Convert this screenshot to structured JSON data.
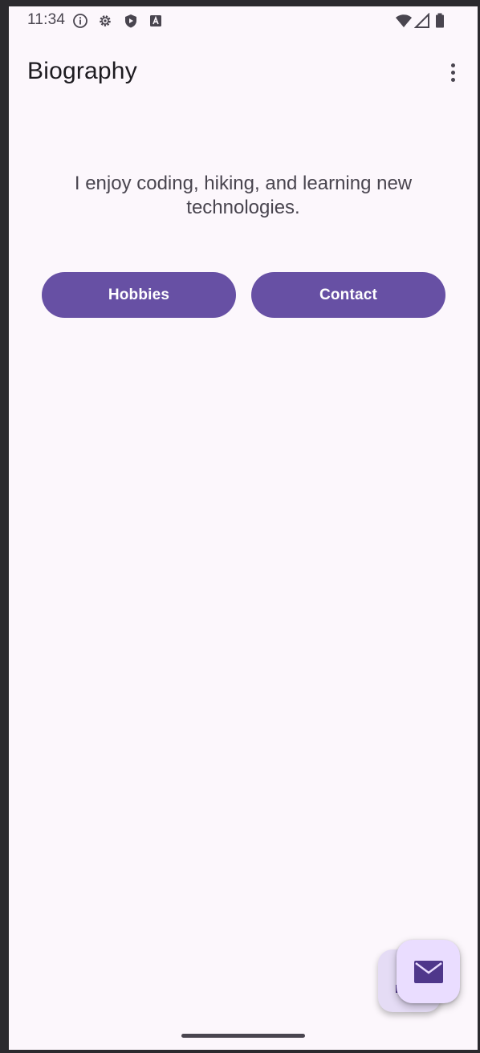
{
  "status_bar": {
    "time": "11:34",
    "icons": [
      "info-icon",
      "settings-gear-icon",
      "shield-icon",
      "keyboard-a-icon",
      "wifi-icon",
      "cell-signal-icon",
      "battery-icon"
    ]
  },
  "app_bar": {
    "title": "Biography",
    "menu_icon": "more-vert-icon"
  },
  "content": {
    "bio_text": "I enjoy coding, hiking, and learning new technologies."
  },
  "buttons": {
    "hobbies_label": "Hobbies",
    "contact_label": "Contact"
  },
  "fab": {
    "icon": "mail-icon"
  },
  "colors": {
    "background": "#fcf7fc",
    "primary": "#6750a4",
    "on_primary": "#ffffff",
    "fab_container": "#eaddff",
    "fab_icon": "#4f378b",
    "text": "#49454f",
    "title": "#1d1b20"
  }
}
